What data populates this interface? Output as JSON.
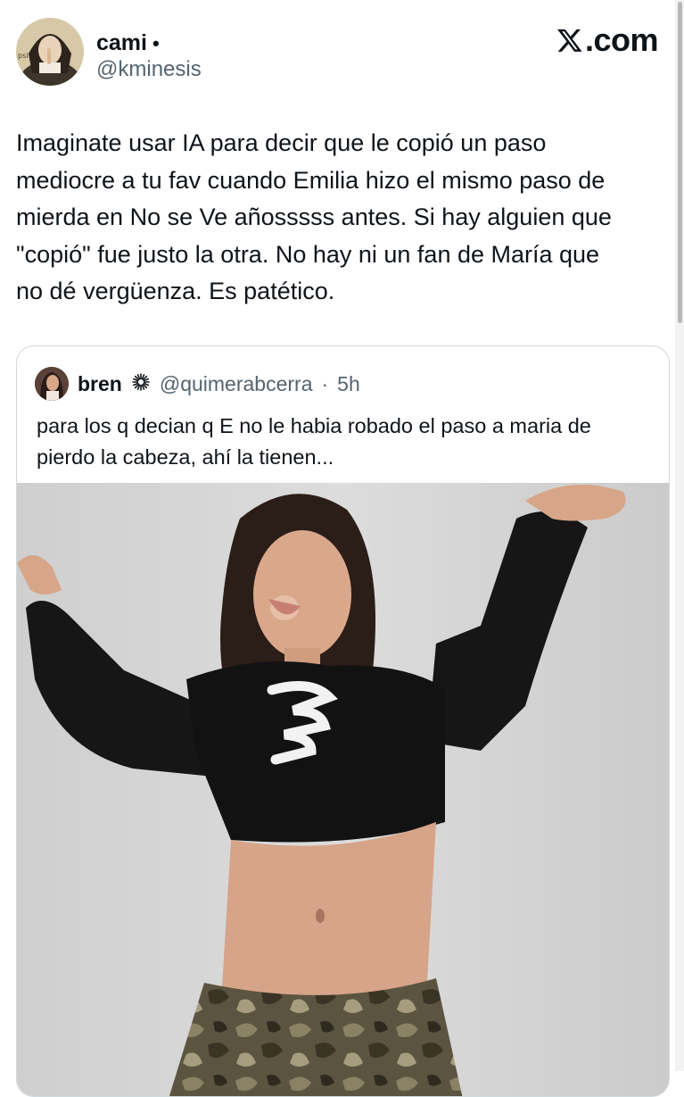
{
  "author": {
    "name": "cami",
    "separator": "•",
    "handle": "@kminesis"
  },
  "brand": {
    "label": ".com",
    "icon": "x-logo-icon"
  },
  "tweet": {
    "text": "Imaginate usar IA para decir que le copió un paso\nmediocre a tu fav cuando Emilia hizo el mismo paso de\nmierda en No se Ve añosssss antes. Si hay alguien que\n\"copió\" fue justo la otra. No hay ni un fan de María que\nno dé vergüenza. Es patético."
  },
  "quoted_tweet": {
    "name": "bren",
    "badge_icon": "sparkle-icon",
    "handle": "@quimerabcerra",
    "dot": "·",
    "time": "5h",
    "text": "para los q decian q E no le habia robado el paso a maria de\npierdo la cabeza, ahí la tienen...",
    "media_icon": "video-frame-image"
  },
  "colors": {
    "text": "#0f1419",
    "secondary": "#536471",
    "border": "#cfd9de",
    "background": "#ffffff"
  }
}
